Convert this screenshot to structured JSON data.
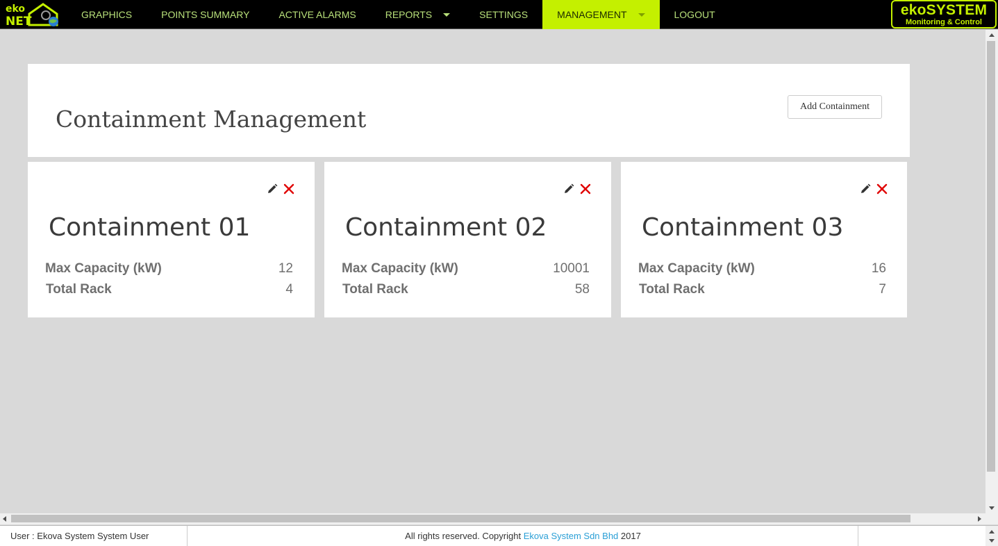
{
  "colors": {
    "nav_bg": "#000000",
    "nav_text": "#b8e07a",
    "accent": "#c4f000",
    "delete_red": "#e00000",
    "link_blue": "#2a9fd6",
    "page_bg": "#d9d9d9"
  },
  "logo_left": {
    "line1": "eko",
    "line2": "NET",
    "icon": "house-globe-logo-icon"
  },
  "nav": {
    "items": [
      {
        "label": "GRAPHICS"
      },
      {
        "label": "POINTS SUMMARY"
      },
      {
        "label": "ACTIVE ALARMS"
      },
      {
        "label": "REPORTS",
        "has_dropdown": true
      },
      {
        "label": "SETTINGS"
      },
      {
        "label": "MANAGEMENT",
        "has_dropdown": true,
        "active": true
      },
      {
        "label": "LOGOUT"
      }
    ]
  },
  "logo_right": {
    "line1": "ekoSYSTEM",
    "line2": "Monitoring & Control"
  },
  "header": {
    "title": "Containment Management",
    "add_button_label": "Add Containment"
  },
  "labels": {
    "max_capacity": "Max Capacity (kW)",
    "total_rack": "Total Rack"
  },
  "icons": {
    "edit": "pencil-icon",
    "delete": "close-x-icon"
  },
  "cards": [
    {
      "name": "Containment 01",
      "max_capacity": "12",
      "total_rack": "4"
    },
    {
      "name": "Containment 02",
      "max_capacity": "10001",
      "total_rack": "58"
    },
    {
      "name": "Containment 03",
      "max_capacity": "16",
      "total_rack": "7"
    }
  ],
  "footer": {
    "user_text": "User : Ekova System System User",
    "copyright_prefix": "All rights reserved. Copyright",
    "company_link": "Ekova System Sdn Bhd",
    "year": "2017"
  }
}
